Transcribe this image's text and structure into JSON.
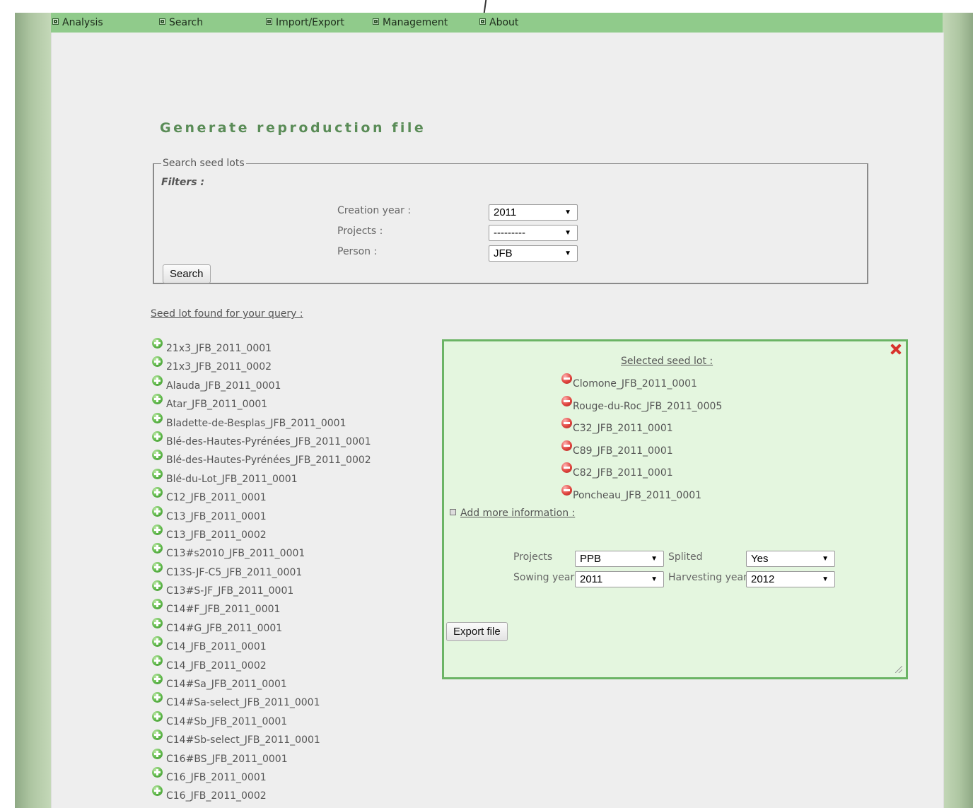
{
  "menu": {
    "items": [
      {
        "label": "Analysis"
      },
      {
        "label": "Search"
      },
      {
        "label": "Import/Export"
      },
      {
        "label": "Management"
      },
      {
        "label": "About"
      }
    ]
  },
  "page": {
    "title": "Generate reproduction file"
  },
  "search_form": {
    "legend": "Search seed lots",
    "filters_label": "Filters :",
    "creation_year_label": "Creation year :",
    "creation_year_value": "2011",
    "projects_label": "Projects :",
    "projects_value": "---------",
    "person_label": "Person :",
    "person_value": "JFB",
    "search_button": "Search"
  },
  "results": {
    "heading": "Seed lot found for your query :",
    "items": [
      "21x3_JFB_2011_0001",
      "21x3_JFB_2011_0002",
      "Alauda_JFB_2011_0001",
      "Atar_JFB_2011_0001",
      "Bladette-de-Besplas_JFB_2011_0001",
      "Blé-des-Hautes-Pyrénées_JFB_2011_0001",
      "Blé-des-Hautes-Pyrénées_JFB_2011_0002",
      "Blé-du-Lot_JFB_2011_0001",
      "C12_JFB_2011_0001",
      "C13_JFB_2011_0001",
      "C13_JFB_2011_0002",
      "C13#s2010_JFB_2011_0001",
      "C13S-JF-C5_JFB_2011_0001",
      "C13#S-JF_JFB_2011_0001",
      "C14#F_JFB_2011_0001",
      "C14#G_JFB_2011_0001",
      "C14_JFB_2011_0001",
      "C14_JFB_2011_0002",
      "C14#Sa_JFB_2011_0001",
      "C14#Sa-select_JFB_2011_0001",
      "C14#Sb_JFB_2011_0001",
      "C14#Sb-select_JFB_2011_0001",
      "C16#BS_JFB_2011_0001",
      "C16_JFB_2011_0001",
      "C16_JFB_2011_0002"
    ]
  },
  "selection_panel": {
    "heading": "Selected seed lot :",
    "items": [
      "Clomone_JFB_2011_0001",
      "Rouge-du-Roc_JFB_2011_0005",
      "C32_JFB_2011_0001",
      "C89_JFB_2011_0001",
      "C82_JFB_2011_0001",
      "Poncheau_JFB_2011_0001"
    ],
    "more_info_label": "Add more information :",
    "projects_label": "Projects",
    "projects_value": "PPB",
    "splited_label": "Splited",
    "splited_value": "Yes",
    "sowing_year_label": "Sowing year",
    "sowing_year_value": "2011",
    "harvesting_year_label": "Harvesting year",
    "harvesting_year_value": "2012",
    "export_button": "Export file"
  },
  "colors": {
    "menu_bar": "#90cb8b",
    "title_green": "#5a8c57",
    "panel_bg": "#e4f6df",
    "panel_border": "#6bb465",
    "close_red": "#d8322c"
  },
  "icons": {
    "add": "plus-circle-icon",
    "remove": "minus-circle-icon",
    "close": "close-icon",
    "menu_bullet": "square-bullet-icon"
  }
}
